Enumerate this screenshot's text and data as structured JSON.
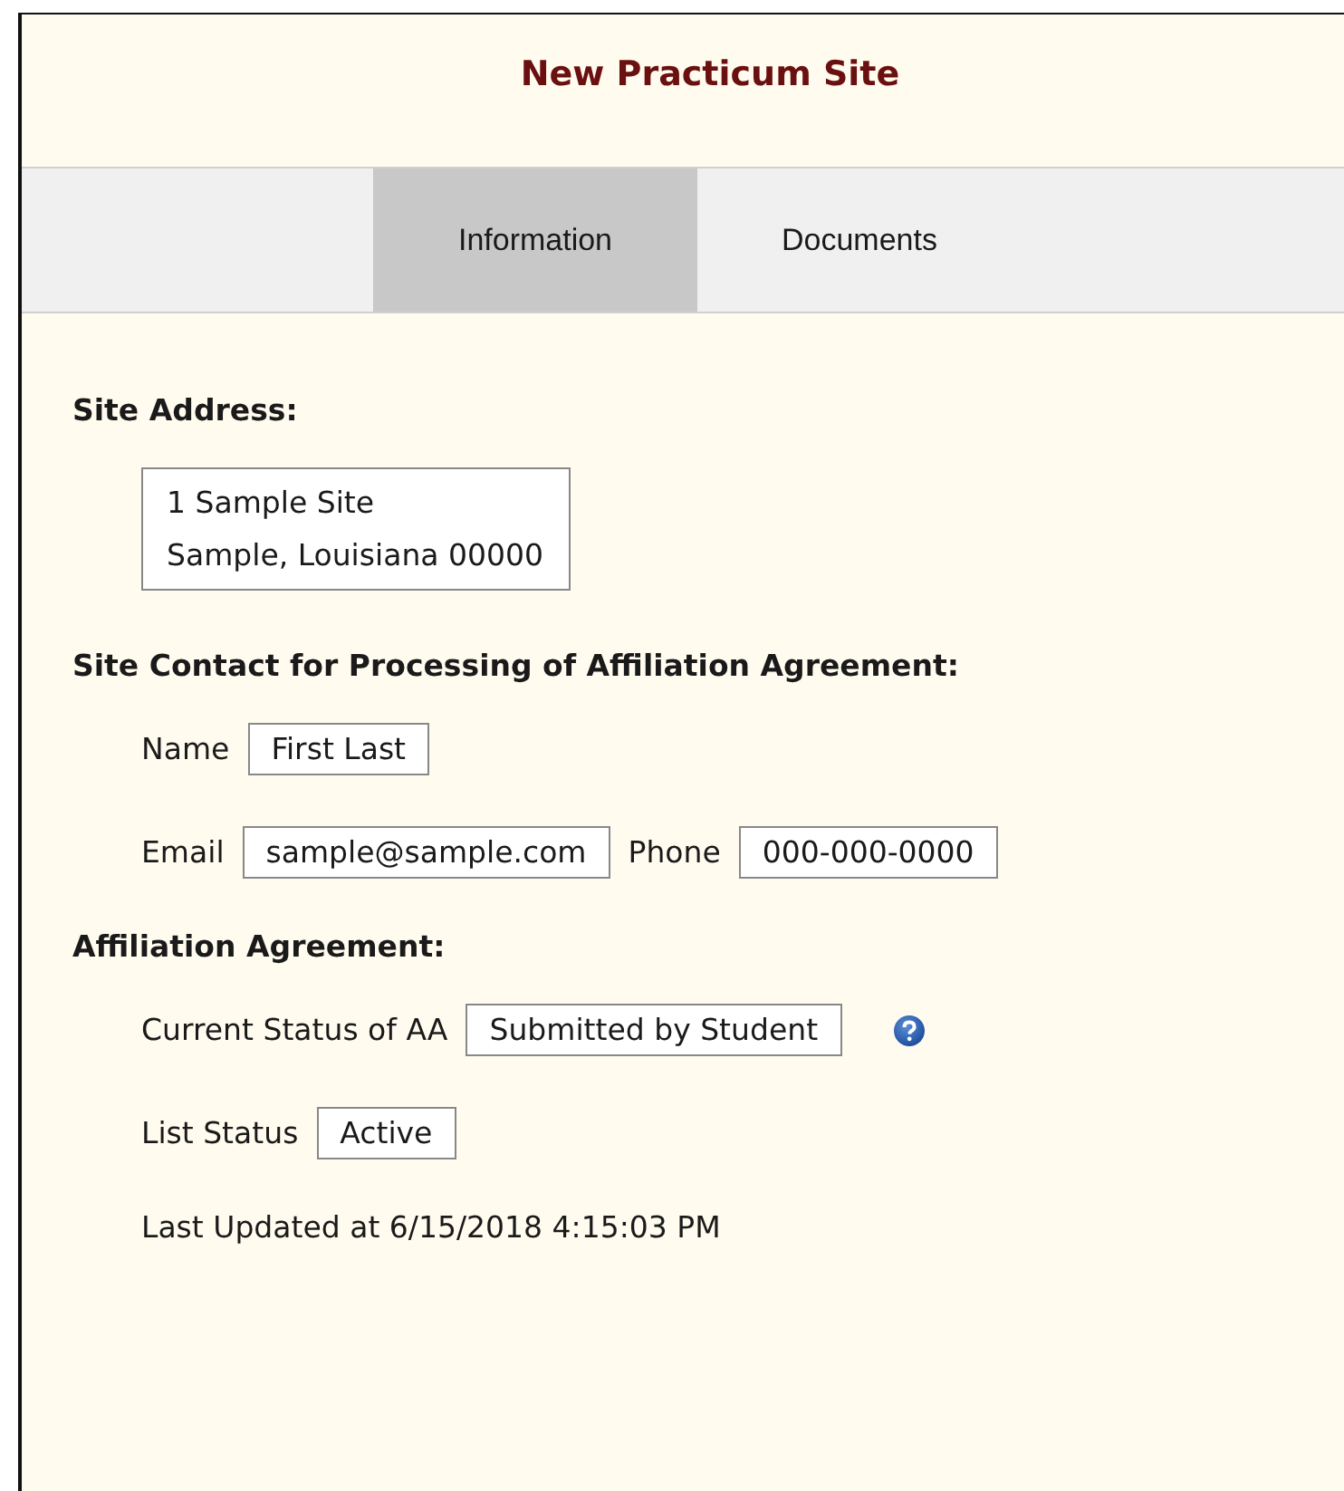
{
  "title": "New Practicum Site",
  "tabs": [
    {
      "label": "Information",
      "selected": true
    },
    {
      "label": "Documents",
      "selected": false
    }
  ],
  "sections": [
    {
      "heading": "Site Address:",
      "kind": "address",
      "lines": [
        "1 Sample Site",
        "Sample, Louisiana 00000"
      ]
    },
    {
      "heading": "Site Contact for Processing of Affiliation Agreement:",
      "kind": "fields",
      "rows": [
        [
          {
            "label": "Name",
            "value": "First Last"
          }
        ],
        [
          {
            "label": "Email",
            "value": "sample@sample.com"
          },
          {
            "label": "Phone",
            "value": "000-000-0000"
          }
        ]
      ]
    },
    {
      "heading": "Affiliation Agreement:",
      "kind": "fields",
      "rows": [
        [
          {
            "label": "Current Status of AA",
            "value": "Submitted by Student",
            "help": true
          }
        ],
        [
          {
            "label": "List Status",
            "value": "Active"
          }
        ]
      ],
      "note": "Last Updated at 6/15/2018 4:15:03 PM"
    }
  ]
}
